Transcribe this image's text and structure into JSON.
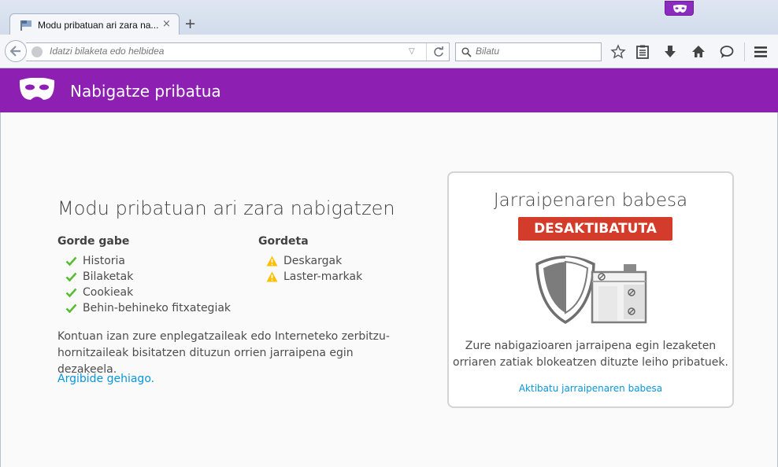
{
  "tab": {
    "title": "Modu pribatuan ari zara na...",
    "close": "×",
    "new_tab": "+"
  },
  "toolbar": {
    "url_placeholder": "Idatzi bilaketa edo helbidea",
    "search_placeholder": "Bilatu",
    "dropmarker": "▽"
  },
  "header": {
    "title": "Nabigatze pribatua"
  },
  "main": {
    "title": "Modu pribatuan ari zara nabigatzen",
    "not_saved_heading": "Gorde gabe",
    "not_saved_items": [
      "Historia",
      "Bilaketak",
      "Cookieak",
      "Behin-behineko fitxategiak"
    ],
    "saved_heading": "Gordeta",
    "saved_items": [
      "Deskargak",
      "Laster-markak"
    ],
    "note_line1": "Kontuan izan zure enplegatzaileak edo Interneteko zerbitzu-",
    "note_line2": "hornitzaileak bisitatzen dituzun orrien jarraipena egin dezakeela.",
    "learn_more": "Argibide gehiago."
  },
  "tracking": {
    "title": "Jarraipenaren babesa",
    "status": "DESAKTIBATUTA",
    "desc_line1": "Zure nabigazioaren jarraipena egin lezaketen",
    "desc_line2": "orriaren zatiak blokeatzen dituzte leiho pribatuek.",
    "enable_link": "Aktibatu jarraipenaren babesa"
  },
  "colors": {
    "private_purple": "#8d1fb3",
    "status_red": "#d33b2b",
    "link_blue": "#0996d9",
    "check_green": "#57bd35",
    "warning_yellow": "#ffbf00"
  },
  "icons": {
    "mask": "private-mask-icon",
    "back": "back-arrow-icon",
    "reload": "reload-icon",
    "search": "magnifier-icon",
    "bookmark": "star-icon",
    "reading_list": "clipboard-icon",
    "downloads": "download-arrow-icon",
    "home": "home-icon",
    "chat": "speech-bubble-icon",
    "menu": "hamburger-menu-icon"
  }
}
